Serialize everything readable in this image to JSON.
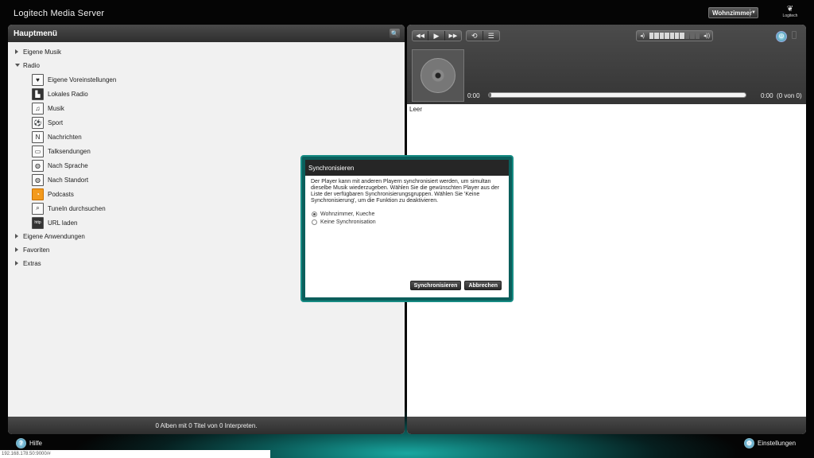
{
  "header": {
    "app_title": "Logitech Media Server",
    "player_name": "Wohnzimmer",
    "logo_text": "Logitech"
  },
  "left": {
    "title": "Hauptmenü",
    "tree": [
      {
        "label": "Eigene Musik",
        "expanded": false
      },
      {
        "label": "Radio",
        "expanded": true,
        "children": [
          {
            "label": "Eigene Voreinstellungen",
            "icon": "heart-icon"
          },
          {
            "label": "Lokales Radio",
            "icon": "city-icon"
          },
          {
            "label": "Musik",
            "icon": "music-note-icon"
          },
          {
            "label": "Sport",
            "icon": "soccer-ball-icon"
          },
          {
            "label": "Nachrichten",
            "icon": "newspaper-icon"
          },
          {
            "label": "Talksendungen",
            "icon": "chat-bubble-icon"
          },
          {
            "label": "Nach Sprache",
            "icon": "globe-icon"
          },
          {
            "label": "Nach Standort",
            "icon": "globe-icon"
          },
          {
            "label": "Podcasts",
            "icon": "rss-icon"
          },
          {
            "label": "TuneIn durchsuchen",
            "icon": "magnifier-icon"
          },
          {
            "label": "URL laden",
            "icon": "http-icon"
          }
        ]
      },
      {
        "label": "Eigene Anwendungen",
        "expanded": false
      },
      {
        "label": "Favoriten",
        "expanded": false
      },
      {
        "label": "Extras",
        "expanded": false
      }
    ],
    "footer_text": "0 Alben mit 0 Titel von 0 Interpreten."
  },
  "player": {
    "time_elapsed": "0:00",
    "time_total": "0:00",
    "track_count": "(0 von 0)",
    "volume_level_fraction": 0.7,
    "progress_fraction": 0.0
  },
  "playlist": {
    "empty_text": "Leer"
  },
  "dialog": {
    "title": "Synchronisieren",
    "description": "Der Player kann mit anderen Playern synchronisiert werden, um simultan dieselbe Musik wiederzugeben. Wählen Sie die gewünschten Player aus der Liste der verfügbaren Synchronisierungsgruppen. Wählen Sie 'Keine Synchronisierung', um die Funktion zu deaktivieren.",
    "options": [
      {
        "label": "Wohnzimmer, Kueche",
        "checked": true
      },
      {
        "label": "Keine Synchronisation",
        "checked": false
      }
    ],
    "sync_button": "Synchronisieren",
    "cancel_button": "Abbrechen"
  },
  "bottom": {
    "help_label": "Hilfe",
    "settings_label": "Einstellungen",
    "status_url": "192.168.178.50:9000/#"
  },
  "colors": {
    "accent_teal": "#168b83",
    "dark_panel": "#2e2e2e"
  }
}
